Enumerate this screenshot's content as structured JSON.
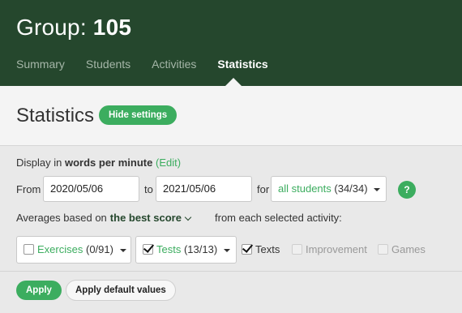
{
  "header": {
    "group_label": "Group:",
    "group_number": "105",
    "tabs": [
      {
        "label": "Summary",
        "active": false
      },
      {
        "label": "Students",
        "active": false
      },
      {
        "label": "Activities",
        "active": false
      },
      {
        "label": "Statistics",
        "active": true
      }
    ]
  },
  "page": {
    "title": "Statistics",
    "hide_settings_label": "Hide settings"
  },
  "settings": {
    "display_prefix": "Display in",
    "display_unit": "words per minute",
    "edit_open": "(",
    "edit_label": "Edit",
    "edit_close": ")",
    "from_label": "From",
    "from_value": "2020/05/06",
    "to_label": "to",
    "to_value": "2021/05/06",
    "for_label": "for",
    "students_select": "all students",
    "students_count": "(34/34)",
    "help_label": "?",
    "averages_prefix": "Averages based on",
    "averages_value": "the best score",
    "averages_suffix": "from each selected activity:",
    "filters": {
      "exercises_label": "Exercises",
      "exercises_count": "(0/91)",
      "exercises_checked": false,
      "tests_label": "Tests",
      "tests_count": "(13/13)",
      "tests_checked": true,
      "texts_label": "Texts",
      "texts_checked": true,
      "improvement_label": "Improvement",
      "improvement_enabled": false,
      "games_label": "Games",
      "games_enabled": false
    },
    "apply_label": "Apply",
    "apply_default_label": "Apply default values"
  },
  "colors": {
    "header_bg": "#25472d",
    "accent_green": "#3cad5f",
    "page_bg": "#e9e9e9"
  }
}
